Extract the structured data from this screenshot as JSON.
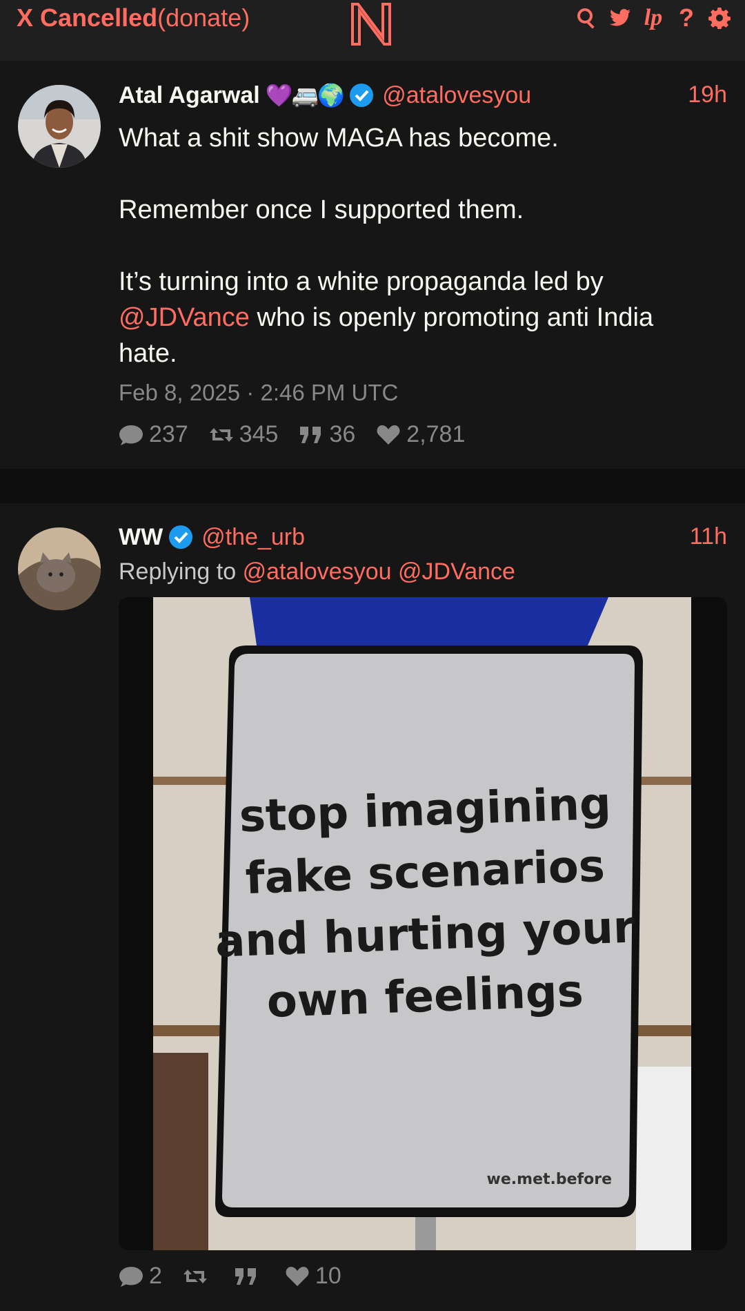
{
  "navbar": {
    "brand_bold": "X Cancelled",
    "brand_rest": "(donate)",
    "logo_letter": "N",
    "icons": [
      "search-icon",
      "bird-icon",
      "lp-icon",
      "help-icon",
      "settings-icon"
    ],
    "lp_glyph": "lp",
    "help_glyph": "?"
  },
  "tweets": [
    {
      "fullname": "Atal Agarwal",
      "emoji": "💜🚐🌍",
      "handle": "@atalovesyou",
      "age": "19h",
      "lines": [
        "What a shit show MAGA has become.",
        "Remember once I supported them.",
        "It’s turning into a white propaganda led by",
        "@JDVance",
        " who is openly promoting anti India hate."
      ],
      "date": "Feb 8, 2025 · 2:46 PM UTC",
      "stats": {
        "replies": "237",
        "retweets": "345",
        "quotes": "36",
        "likes": "2,781"
      }
    },
    {
      "fullname": "WW",
      "handle": "@the_urb",
      "age": "11h",
      "replying_prefix": "Replying to",
      "replying_to": [
        "@atalovesyou",
        "@JDVance"
      ],
      "image_text": [
        "stop imagining",
        "fake scenarios",
        "and hurting your",
        "own feelings"
      ],
      "watermark": "we.met.before",
      "stats": {
        "replies": "2",
        "retweets": "",
        "quotes": "",
        "likes": "10"
      }
    }
  ],
  "colors": {
    "accent": "#ff6c60",
    "bg": "#0f0f0f",
    "card": "#161616",
    "muted": "#888888",
    "verified": "#1d9bf0"
  }
}
